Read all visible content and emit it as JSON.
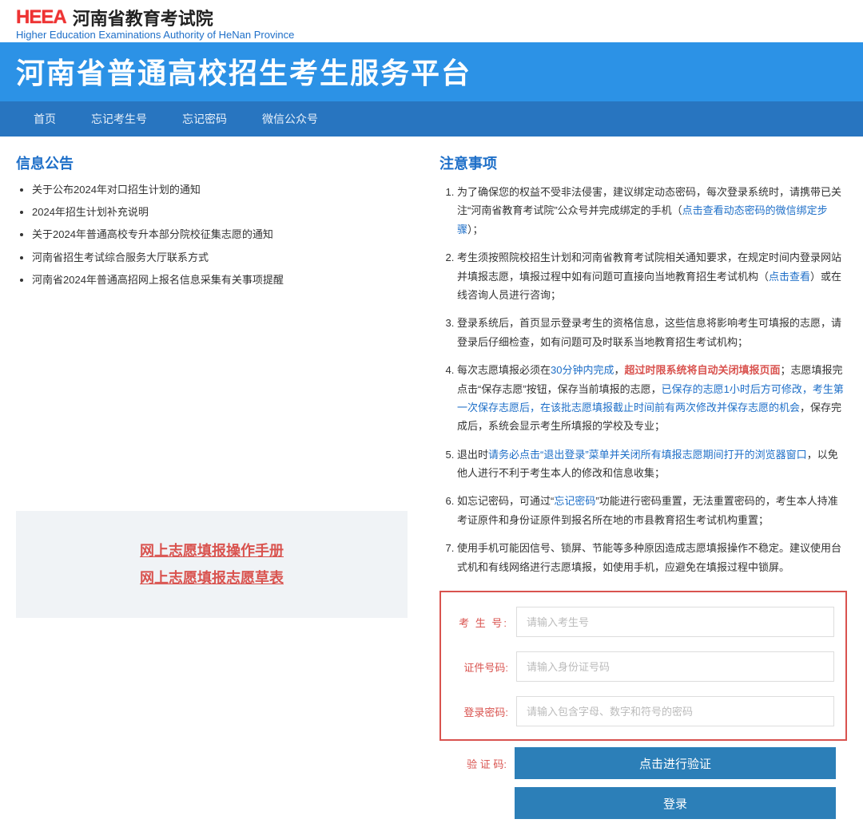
{
  "header": {
    "logo_mark": "HEEA",
    "logo_cn": "河南省教育考试院",
    "logo_en": "Higher Education Examinations Authority of HeNan Province",
    "platform_title": "河南省普通高校招生考生服务平台"
  },
  "nav": [
    "首页",
    "忘记考生号",
    "忘记密码",
    "微信公众号"
  ],
  "announcements": {
    "title": "信息公告",
    "items": [
      "关于公布2024年对口招生计划的通知",
      "2024年招生计划补充说明",
      "关于2024年普通高校专升本部分院校征集志愿的通知",
      "河南省招生考试综合服务大厅联系方式",
      "河南省2024年普通高招网上报名信息采集有关事项提醒"
    ]
  },
  "manual_links": {
    "link1": "网上志愿填报操作手册",
    "link2": "网上志愿填报志愿草表"
  },
  "notices": {
    "title": "注意事项",
    "n1_a": "为了确保您的权益不受非法侵害，建议绑定动态密码，每次登录系统时，请携带已关注“河南省教育考试院”公众号并完成绑定的手机（",
    "n1_link": "点击查看动态密码的微信绑定步骤",
    "n1_b": "）；",
    "n2_a": "考生须按照院校招生计划和河南省教育考试院相关通知要求，在规定时间内登录网站并填报志愿，填报过程中如有问题可直接向当地教育招生考试机构（",
    "n2_link": "点击查看",
    "n2_b": "）或在线咨询人员进行咨询；",
    "n3": "登录系统后，首页显示登录考生的资格信息，这些信息将影响考生可填报的志愿，请登录后仔细检查，如有问题可及时联系当地教育招生考试机构；",
    "n4_a": "每次志愿填报必须在",
    "n4_blue1": "30分钟内完成",
    "n4_b": "，",
    "n4_red": "超过时限系统将自动关闭填报页面",
    "n4_c": "；志愿填报完点击“保存志愿”按钮，保存当前填报的志愿，",
    "n4_blue2": "已保存的志愿1小时后方可修改，考生第一次保存志愿后，在该批志愿填报截止时间前有两次修改并保存志愿的机会",
    "n4_d": "，保存完成后，系统会显示考生所填报的学校及专业；",
    "n5_a": "退出时",
    "n5_blue": "请务必点击“退出登录”菜单并关闭所有填报志愿期间打开的浏览器窗口",
    "n5_b": "，以免他人进行不利于考生本人的修改和信息收集；",
    "n6_a": "如忘记密码，可通过“",
    "n6_link": "忘记密码",
    "n6_b": "”功能进行密码重置，无法重置密码的，考生本人持准考证原件和身份证原件到报名所在地的市县教育招生考试机构重置；",
    "n7": "使用手机可能因信号、锁屏、节能等多种原因造成志愿填报操作不稳定。建议使用台式机和有线网络进行志愿填报，如使用手机，应避免在填报过程中锁屏。"
  },
  "login": {
    "label_id": "考 生 号:",
    "ph_id": "请输入考生号",
    "label_cert": "证件号码:",
    "ph_cert": "请输入身份证号码",
    "label_pwd": "登录密码:",
    "ph_pwd": "请输入包含字母、数字和符号的密码",
    "label_verify": "验 证 码:",
    "btn_verify": "点击进行验证",
    "btn_login": "登录"
  }
}
